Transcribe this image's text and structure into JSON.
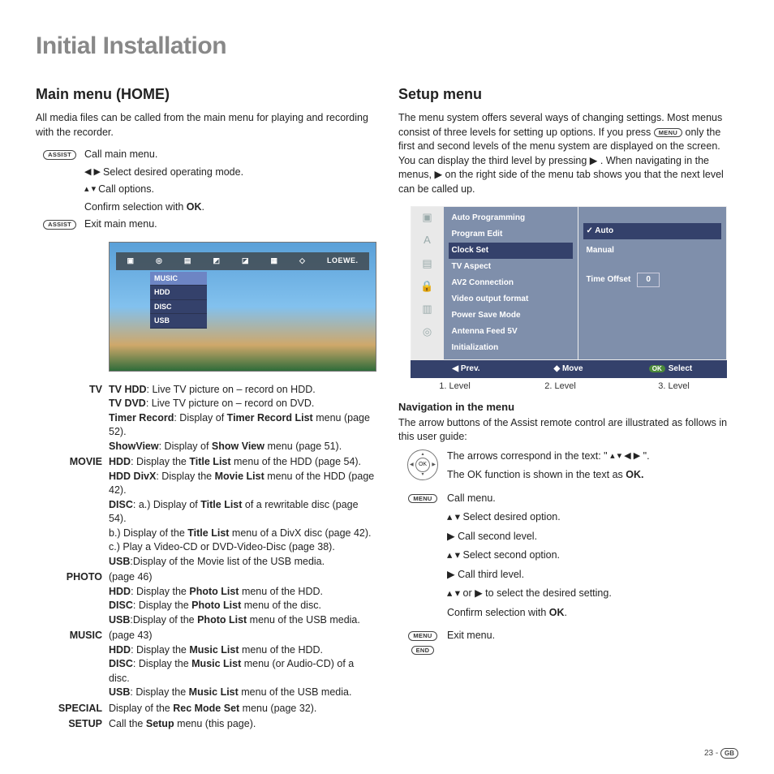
{
  "pageTitle": "Initial Installation",
  "left": {
    "heading": "Main menu (HOME)",
    "intro": "All media files can be called from the main menu for playing and recording with the recorder.",
    "steps": {
      "assist1": "ASSIST",
      "callMain": "Call main menu.",
      "selectMode_pre": "◀  ▶ ",
      "selectMode": "Select desired operating mode.",
      "callOptions_pre": "▴  ▾ ",
      "callOptions": "Call options.",
      "confirmPre": "Confirm selection with ",
      "confirmBold": "OK",
      "confirmPost": ".",
      "assist2": "ASSIST",
      "exitMain": "Exit main menu."
    },
    "tv": {
      "brand": "LOEWE.",
      "menuTitle": "MUSIC",
      "items": [
        "HDD",
        "DISC",
        "USB"
      ]
    },
    "desc": {
      "tv": {
        "term": "TV",
        "lines": [
          "<b>TV HDD</b>: Live TV picture on – record on HDD.",
          "<b>TV DVD</b>: Live TV picture on – record on DVD.",
          "<b>Timer Record</b>: Display of <b>Timer Record List</b> menu (page 52).",
          "<b>ShowView</b>: Display of <b>Show View</b> menu (page 51)."
        ]
      },
      "movie": {
        "term": "MOVIE",
        "lines": [
          "<b>HDD</b>: Display the <b>Title List</b> menu of the HDD (page 54).",
          "<b>HDD DivX</b>: Display the <b>Movie List</b> menu of the HDD (page 42).",
          "<b>DISC</b>: a.) Display of <b>Title List</b> of a rewritable disc (page 54).",
          "b.) Display of the <b>Title List</b> menu of a DivX disc (page 42).",
          "c.) Play a Video-CD or DVD-Video-Disc (page 38).",
          "<b>USB</b>:Display of the Movie list of the USB media."
        ]
      },
      "photo": {
        "term": "PHOTO",
        "lines": [
          "(page 46)",
          "<b>HDD</b>: Display the <b>Photo List</b> menu of the HDD.",
          "<b>DISC</b>: Display the <b>Photo List</b> menu of the disc.",
          "<b>USB</b>:Display of the <b>Photo List</b> menu of the USB media."
        ]
      },
      "music": {
        "term": "MUSIC",
        "lines": [
          "(page 43)",
          "<b>HDD</b>: Display the <b>Music List</b> menu of the HDD.",
          "<b>DISC</b>: Display the <b>Music List</b> menu (or Audio-CD) of a disc.",
          "<b>USB</b>: Display the <b>Music List</b> menu of the USB media."
        ]
      },
      "special": {
        "term": "SPECIAL",
        "line": "Display of the <b>Rec Mode Set</b> menu (page 32)."
      },
      "setup": {
        "term": "SETUP",
        "line": "Call the <b>Setup</b> menu  (this page)."
      }
    }
  },
  "right": {
    "heading": "Setup menu",
    "intro": {
      "pre": "The menu system offers several ways of changing settings. Most menus consist of three levels for setting up options. If you press ",
      "btn": "MENU",
      "mid": " only the first and second levels of the menu system are displayed on the screen. You can display the third level by pressing  ▶ . When navigating in the menus,  ▶  on the right side of the menu tab shows you that the next level can be called up."
    },
    "setup": {
      "col2": [
        "Auto Programming",
        "Program Edit",
        "Clock Set",
        "TV Aspect",
        "AV2 Connection",
        "Video output format",
        "Power Save Mode",
        "Antenna Feed 5V",
        "Initialization"
      ],
      "col2_selected": "Clock Set",
      "col3_auto": "Auto",
      "col3_manual": "Manual",
      "col3_time": "Time Offset",
      "col3_time_val": "0",
      "footer_prev": "◀  Prev.",
      "footer_move": "◆ Move",
      "footer_select_ok": "OK",
      "footer_select": "Select",
      "levels": [
        "1. Level",
        "2. Level",
        "3. Level"
      ]
    },
    "navHead": "Navigation in the menu",
    "navIntro": "The arrow buttons of the Assist remote control are illustrated as follows in this user guide:",
    "nav": {
      "arrowsLine_pre": "The arrows correspond in the text: \" ",
      "arrowsLine_arrows": "▴  ▾  ◀  ▶",
      "arrowsLine_post": " \".",
      "okLine_pre": "The OK function is shown in the text as ",
      "okLine_bold": "OK.",
      "menuBtn": "MENU",
      "callMenu": "Call menu.",
      "ud": "▴  ▾  Select desired option.",
      "r1": "▶  Call second level.",
      "ud2": "▴  ▾  Select second option.",
      "r2": "▶  Call third level.",
      "ud3": "▴  ▾  or  ▶  to select the desired setting.",
      "confirmPre": "Confirm selection with ",
      "confirmBold": "OK",
      "confirmPost": ".",
      "exitBtns": [
        "MENU",
        "END"
      ],
      "exit": "Exit menu."
    }
  },
  "footer": {
    "page": "23 - ",
    "lang": "GB"
  }
}
